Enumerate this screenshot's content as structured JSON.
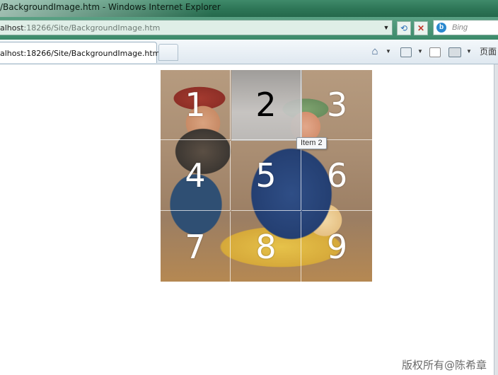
{
  "window": {
    "title": "/BackgroundImage.htm - Windows Internet Explorer"
  },
  "address_bar": {
    "url_host": "alhost",
    "url_rest": ":18266/Site/BackgroundImage.htm"
  },
  "search": {
    "provider": "Bing",
    "placeholder": "Bing"
  },
  "tabs": [
    {
      "label": "alhost:18266/Site/BackgroundImage.htm"
    }
  ],
  "command_bar": {
    "page_label": "页面"
  },
  "grid": {
    "cells": [
      "1",
      "2",
      "3",
      "4",
      "5",
      "6",
      "7",
      "8",
      "9"
    ],
    "hovered_index": 1
  },
  "tooltip": {
    "text": "Item 2"
  },
  "watermark": "版权所有@陈希章"
}
